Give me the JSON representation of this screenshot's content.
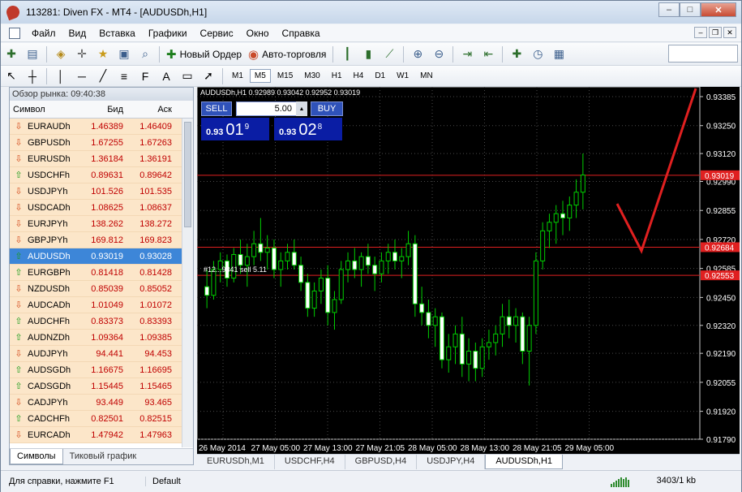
{
  "window": {
    "title": "113281: Diven FX - MT4 - [AUDUSDh,H1]",
    "min": "–",
    "max": "□",
    "close": "✕"
  },
  "menu": [
    "Файл",
    "Вид",
    "Вставка",
    "Графики",
    "Сервис",
    "Окно",
    "Справка"
  ],
  "toolbar": {
    "new_order": "Новый Ордер",
    "auto_trading": "Авто-торговля"
  },
  "timeframes": [
    "M1",
    "M5",
    "M15",
    "M30",
    "H1",
    "H4",
    "D1",
    "W1",
    "MN"
  ],
  "active_timeframe": "M5",
  "market_watch": {
    "title": "Обзор рынка: 09:40:38",
    "headers": {
      "symbol": "Символ",
      "bid": "Бид",
      "ask": "Аск"
    },
    "rows": [
      {
        "s": "EURAUDh",
        "b": "1.46389",
        "a": "1.46409",
        "d": "down"
      },
      {
        "s": "GBPUSDh",
        "b": "1.67255",
        "a": "1.67263",
        "d": "down"
      },
      {
        "s": "EURUSDh",
        "b": "1.36184",
        "a": "1.36191",
        "d": "down"
      },
      {
        "s": "USDCHFh",
        "b": "0.89631",
        "a": "0.89642",
        "d": "up"
      },
      {
        "s": "USDJPYh",
        "b": "101.526",
        "a": "101.535",
        "d": "down"
      },
      {
        "s": "USDCADh",
        "b": "1.08625",
        "a": "1.08637",
        "d": "down"
      },
      {
        "s": "EURJPYh",
        "b": "138.262",
        "a": "138.272",
        "d": "down"
      },
      {
        "s": "GBPJPYh",
        "b": "169.812",
        "a": "169.823",
        "d": "down"
      },
      {
        "s": "AUDUSDh",
        "b": "0.93019",
        "a": "0.93028",
        "d": "up"
      },
      {
        "s": "EURGBPh",
        "b": "0.81418",
        "a": "0.81428",
        "d": "up"
      },
      {
        "s": "NZDUSDh",
        "b": "0.85039",
        "a": "0.85052",
        "d": "down"
      },
      {
        "s": "AUDCADh",
        "b": "1.01049",
        "a": "1.01072",
        "d": "down"
      },
      {
        "s": "AUDCHFh",
        "b": "0.83373",
        "a": "0.83393",
        "d": "up"
      },
      {
        "s": "AUDNZDh",
        "b": "1.09364",
        "a": "1.09385",
        "d": "up"
      },
      {
        "s": "AUDJPYh",
        "b": "94.441",
        "a": "94.453",
        "d": "down"
      },
      {
        "s": "AUDSGDh",
        "b": "1.16675",
        "a": "1.16695",
        "d": "up"
      },
      {
        "s": "CADSGDh",
        "b": "1.15445",
        "a": "1.15465",
        "d": "up"
      },
      {
        "s": "CADJPYh",
        "b": "93.449",
        "a": "93.465",
        "d": "down"
      },
      {
        "s": "CADCHFh",
        "b": "0.82501",
        "a": "0.82515",
        "d": "up"
      },
      {
        "s": "EURCADh",
        "b": "1.47942",
        "a": "1.47963",
        "d": "down"
      }
    ],
    "selected": 8,
    "tabs": [
      "Символы",
      "Тиковый график"
    ]
  },
  "chart": {
    "header": "AUDUSDh,H1  0.92989 0.93042 0.92952 0.93019",
    "trade": {
      "sell": "SELL",
      "buy": "BUY",
      "lot": "5.00",
      "sell_small": "0.93",
      "sell_big": "01",
      "sell_sup": "9",
      "buy_small": "0.93",
      "buy_big": "02",
      "buy_sup": "8"
    },
    "order_label": "#12...9841 sell 5.11",
    "price_labels": [
      "0.93385",
      "0.93250",
      "0.93120",
      "0.92990",
      "0.92855",
      "0.92720",
      "0.92585",
      "0.92450",
      "0.92320",
      "0.92190",
      "0.92055",
      "0.91920",
      "0.91790"
    ],
    "red_labels": [
      "0.93019",
      "0.92684",
      "0.92553"
    ],
    "time_labels": [
      "26 May 2014",
      "27 May 05:00",
      "27 May 13:00",
      "27 May 21:05",
      "28 May 05:00",
      "28 May 13:00",
      "28 May 21:05",
      "29 May 05:00"
    ],
    "tabs": [
      "EURUSDh,M1",
      "USDCHF,H4",
      "GBPUSD,H4",
      "USDJPY,H4",
      "AUDUSDh,H1"
    ],
    "active_tab": 4
  },
  "chart_data": {
    "type": "candlestick",
    "symbol": "AUDUSDh",
    "timeframe": "H1",
    "ylim": [
      0.9179,
      0.93385
    ],
    "candles": [
      [
        0.925,
        0.9258,
        0.924,
        0.9246
      ],
      [
        0.9246,
        0.9262,
        0.9244,
        0.9258
      ],
      [
        0.9258,
        0.9266,
        0.9252,
        0.9262
      ],
      [
        0.9262,
        0.9265,
        0.925,
        0.9254
      ],
      [
        0.9254,
        0.9268,
        0.9252,
        0.9265
      ],
      [
        0.9265,
        0.9272,
        0.9256,
        0.926
      ],
      [
        0.926,
        0.927,
        0.925,
        0.9264
      ],
      [
        0.9264,
        0.9276,
        0.926,
        0.927
      ],
      [
        0.927,
        0.9282,
        0.9262,
        0.9266
      ],
      [
        0.9266,
        0.9274,
        0.9258,
        0.9268
      ],
      [
        0.9268,
        0.9272,
        0.9254,
        0.9258
      ],
      [
        0.9258,
        0.9266,
        0.925,
        0.9262
      ],
      [
        0.9262,
        0.927,
        0.9258,
        0.9266
      ],
      [
        0.9266,
        0.9272,
        0.9258,
        0.926
      ],
      [
        0.926,
        0.9264,
        0.9248,
        0.9252
      ],
      [
        0.9252,
        0.9256,
        0.9236,
        0.924
      ],
      [
        0.924,
        0.9252,
        0.9236,
        0.9248
      ],
      [
        0.9248,
        0.9258,
        0.9242,
        0.9254
      ],
      [
        0.9254,
        0.926,
        0.9232,
        0.9238
      ],
      [
        0.9238,
        0.9248,
        0.923,
        0.9244
      ],
      [
        0.9244,
        0.9262,
        0.9242,
        0.9258
      ],
      [
        0.9258,
        0.9266,
        0.9252,
        0.9262
      ],
      [
        0.9262,
        0.9268,
        0.9254,
        0.9258
      ],
      [
        0.9258,
        0.9266,
        0.925,
        0.9264
      ],
      [
        0.9264,
        0.927,
        0.9256,
        0.926
      ],
      [
        0.926,
        0.9264,
        0.9248,
        0.9256
      ],
      [
        0.9256,
        0.9266,
        0.9252,
        0.9262
      ],
      [
        0.9262,
        0.927,
        0.9256,
        0.9266
      ],
      [
        0.9266,
        0.9272,
        0.9258,
        0.9262
      ],
      [
        0.9262,
        0.9268,
        0.9254,
        0.9264
      ],
      [
        0.9264,
        0.9276,
        0.926,
        0.927
      ],
      [
        0.927,
        0.9274,
        0.9236,
        0.9242
      ],
      [
        0.9242,
        0.925,
        0.9232,
        0.9238
      ],
      [
        0.9238,
        0.9244,
        0.9226,
        0.9232
      ],
      [
        0.9232,
        0.924,
        0.9222,
        0.9236
      ],
      [
        0.9236,
        0.9238,
        0.9212,
        0.9216
      ],
      [
        0.9216,
        0.9228,
        0.921,
        0.9222
      ],
      [
        0.9222,
        0.9232,
        0.9214,
        0.9228
      ],
      [
        0.9228,
        0.9236,
        0.9208,
        0.9214
      ],
      [
        0.9214,
        0.9226,
        0.9206,
        0.922
      ],
      [
        0.922,
        0.9224,
        0.9206,
        0.9212
      ],
      [
        0.9212,
        0.9226,
        0.9208,
        0.9222
      ],
      [
        0.9222,
        0.923,
        0.9216,
        0.9224
      ],
      [
        0.9224,
        0.9232,
        0.9218,
        0.9228
      ],
      [
        0.9228,
        0.9242,
        0.9222,
        0.9236
      ],
      [
        0.9236,
        0.9244,
        0.9226,
        0.9232
      ],
      [
        0.9232,
        0.924,
        0.9224,
        0.9236
      ],
      [
        0.9236,
        0.9238,
        0.9214,
        0.922
      ],
      [
        0.922,
        0.9236,
        0.9204,
        0.9232
      ],
      [
        0.9232,
        0.9266,
        0.9228,
        0.9262
      ],
      [
        0.9262,
        0.928,
        0.9258,
        0.9276
      ],
      [
        0.9276,
        0.9284,
        0.9268,
        0.928
      ],
      [
        0.928,
        0.9288,
        0.927,
        0.9284
      ],
      [
        0.9284,
        0.929,
        0.9274,
        0.9282
      ],
      [
        0.9282,
        0.9292,
        0.9276,
        0.9288
      ],
      [
        0.9288,
        0.93,
        0.9282,
        0.9294
      ],
      [
        0.9294,
        0.9312,
        0.9286,
        0.9302
      ]
    ],
    "hlines": [
      0.93019,
      0.92684,
      0.92553
    ]
  }
}
